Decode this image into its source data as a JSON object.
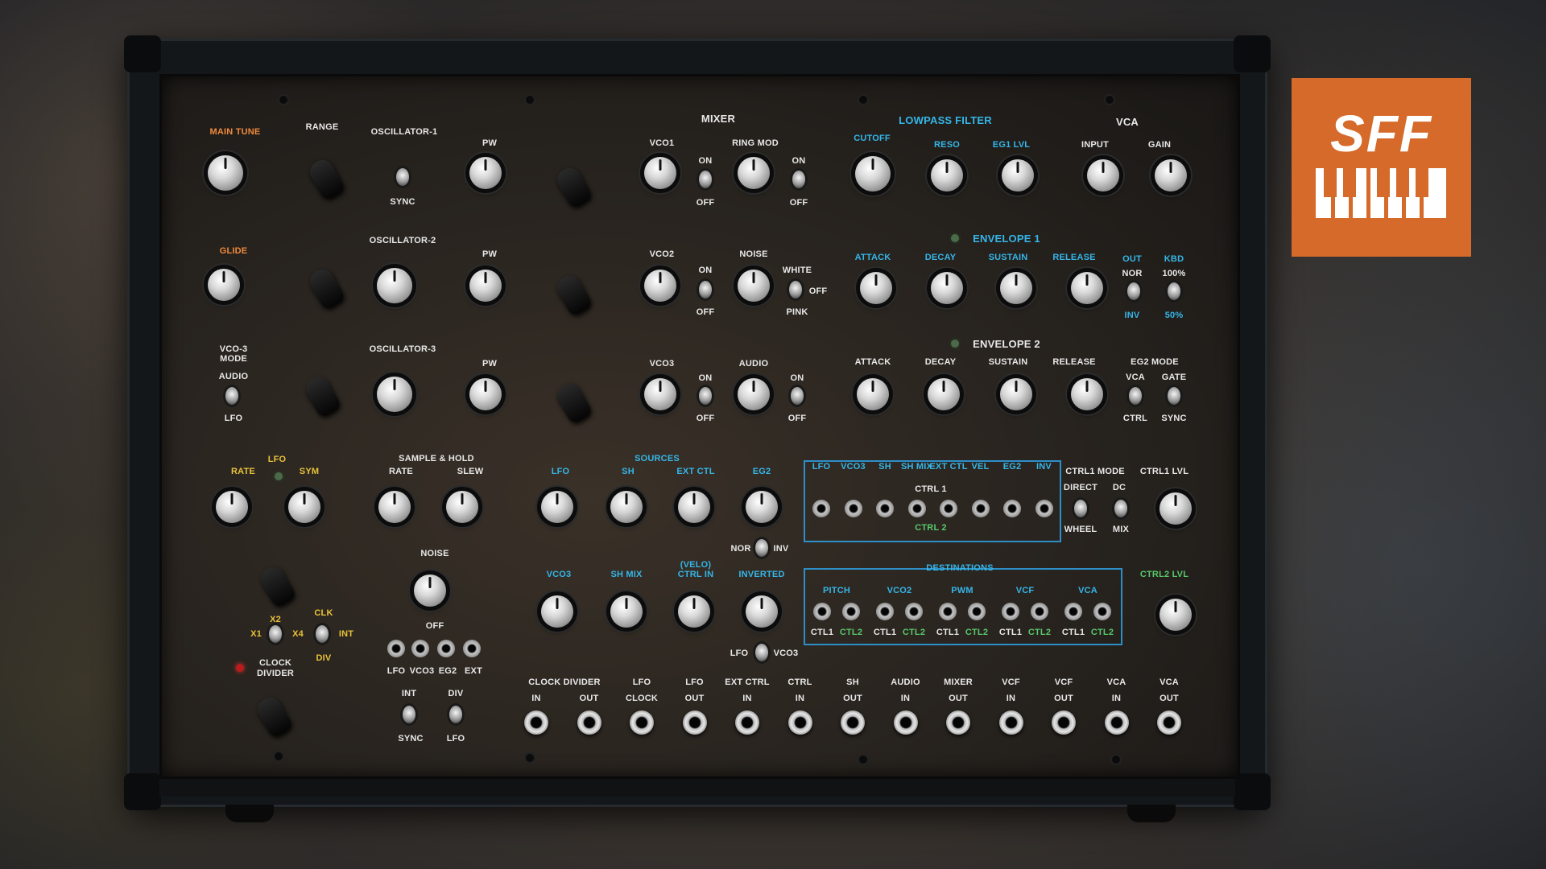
{
  "logo": {
    "text": "SFF",
    "mark": "piano-keys-icon",
    "color": "#d66a2a"
  },
  "panel": {
    "headers": {
      "mixer": "MIXER",
      "lowpass_filter": "LOWPASS FILTER",
      "vca": "VCA",
      "envelope1": "ENVELOPE 1",
      "envelope2": "ENVELOPE 2",
      "sources": "SOURCES",
      "destinations": "DESTINATIONS",
      "sample_hold": "SAMPLE & HOLD",
      "lfo": "LFO",
      "ctrl1": "CTRL 1",
      "ctrl2": "CTRL 2",
      "off": "OFF"
    },
    "labels": {
      "main_tune": "MAIN TUNE",
      "range": "RANGE",
      "osc1": "OSCILLATOR-1",
      "osc2": "OSCILLATOR-2",
      "osc3": "OSCILLATOR-3",
      "pw": "PW",
      "sync": "SYNC",
      "glide": "GLIDE",
      "vco3_mode_a": "VCO-3",
      "vco3_mode_b": "MODE",
      "audio": "AUDIO",
      "lfo": "LFO",
      "vco1": "VCO1",
      "vco2": "VCO2",
      "vco3": "VCO3",
      "ring_mod": "RING MOD",
      "noise": "NOISE",
      "on": "ON",
      "off": "OFF",
      "white": "WHITE",
      "pink": "PINK",
      "cutoff": "CUTOFF",
      "reso": "RESO",
      "eg1_lvl": "EG1 LVL",
      "input": "INPUT",
      "gain": "GAIN",
      "attack": "ATTACK",
      "decay": "DECAY",
      "sustain": "SUSTAIN",
      "release": "RELEASE",
      "out": "OUT",
      "kbd": "KBD",
      "nor": "NOR",
      "inv": "INV",
      "pct100": "100%",
      "pct50": "50%",
      "eg2_mode": "EG2 MODE",
      "gate": "GATE",
      "ctrl": "CTRL",
      "rate": "RATE",
      "sym": "SYM",
      "slew": "SLEW",
      "sh": "SH",
      "ext_ctl": "EXT CTL",
      "eg2": "EG2",
      "sh_mix": "SH MIX",
      "velo_a": "(VELO)",
      "velo_b": "CTRL IN",
      "inverted": "INVERTED",
      "x1": "X1",
      "x2": "X2",
      "x4": "X4",
      "clk": "CLK",
      "int": "INT",
      "div": "DIV",
      "clock_divider_a": "CLOCK",
      "clock_divider_b": "DIVIDER",
      "vco3_tag": "VCO3",
      "eg2_tag": "EG2",
      "ext_tag": "EXT",
      "lfo_tag": "LFO",
      "ctrl1_mode": "CTRL1 MODE",
      "ctrl1_lvl": "CTRL1 LVL",
      "ctrl2_lvl": "CTRL2 LVL",
      "direct": "DIRECT",
      "dc": "DC",
      "wheel": "WHEEL",
      "mix": "MIX",
      "pitch": "PITCH",
      "pwm": "PWM",
      "vcf": "VCF",
      "vca": "VCA",
      "ctl1": "CTL1",
      "ctl2": "CTL2"
    },
    "ctrl_sources": [
      "LFO",
      "VCO3",
      "SH",
      "SH MIX",
      "EXT CTL",
      "VEL",
      "EG2",
      "INV"
    ],
    "patch_bay": [
      {
        "top": "CLOCK DIVIDER",
        "bottom": "IN"
      },
      {
        "top": "",
        "bottom": "OUT"
      },
      {
        "top": "LFO",
        "bottom": "CLOCK"
      },
      {
        "top": "LFO",
        "bottom": "OUT"
      },
      {
        "top": "EXT CTRL",
        "bottom": "IN"
      },
      {
        "top": "CTRL",
        "bottom": "IN"
      },
      {
        "top": "SH",
        "bottom": "OUT"
      },
      {
        "top": "AUDIO",
        "bottom": "IN"
      },
      {
        "top": "MIXER",
        "bottom": "OUT"
      },
      {
        "top": "VCF",
        "bottom": "IN"
      },
      {
        "top": "VCF",
        "bottom": "OUT"
      },
      {
        "top": "VCA",
        "bottom": "IN"
      },
      {
        "top": "VCA",
        "bottom": "OUT"
      }
    ]
  }
}
